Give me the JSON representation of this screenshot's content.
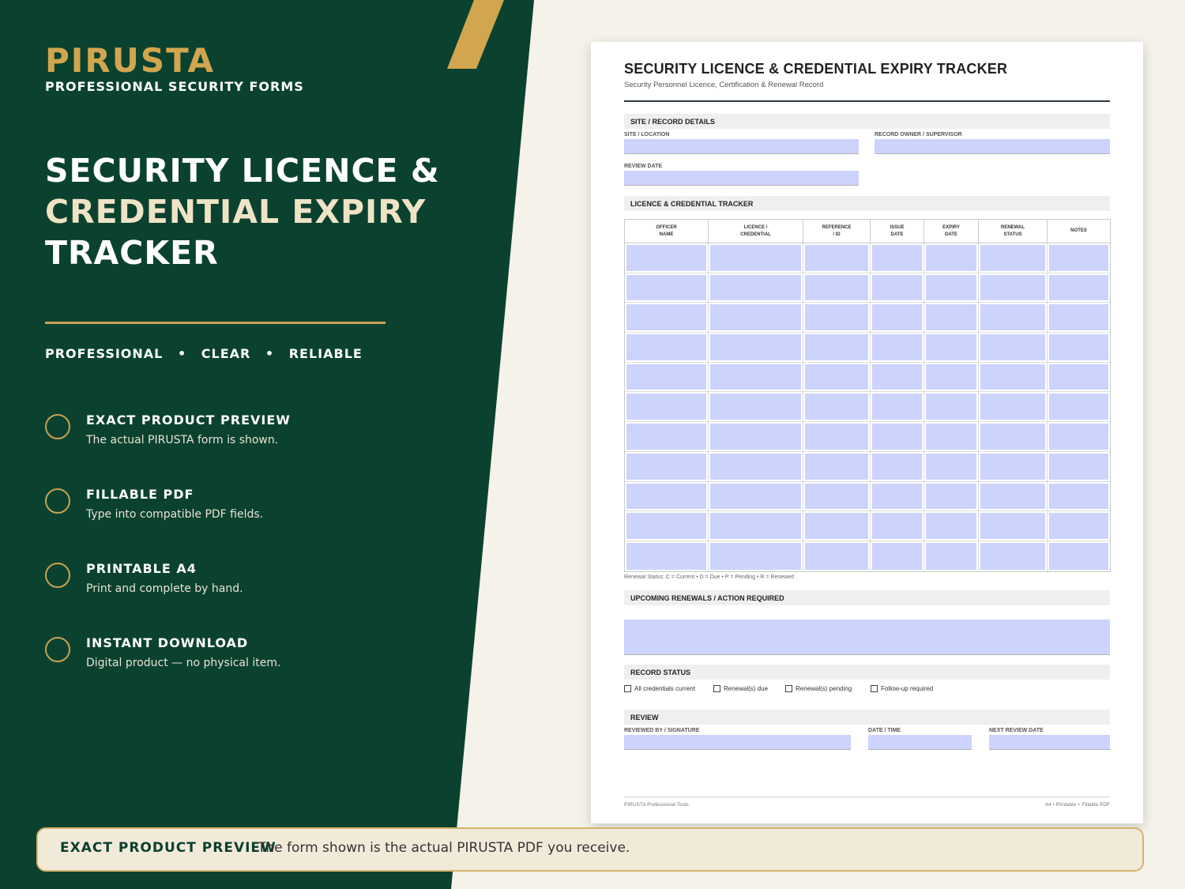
{
  "colors": {
    "panel_green": "#0b422f",
    "gold": "#d2a64e",
    "cream": "#f5f2ea",
    "field_fill": "#ccd3fd"
  },
  "brand": {
    "name": "PIRUSTA",
    "subtitle": "PROFESSIONAL SECURITY FORMS"
  },
  "hero": {
    "line1": "SECURITY LICENCE &",
    "line2": "CREDENTIAL EXPIRY",
    "line3": "TRACKER"
  },
  "tagline": {
    "items": [
      "PROFESSIONAL",
      "CLEAR",
      "RELIABLE"
    ],
    "separator": "•"
  },
  "features": [
    {
      "icon": "circle-icon",
      "title": "EXACT PRODUCT PREVIEW",
      "desc": "The actual PIRUSTA form is shown."
    },
    {
      "icon": "circle-icon",
      "title": "FILLABLE PDF",
      "desc": "Type into compatible PDF fields."
    },
    {
      "icon": "circle-icon",
      "title": "PRINTABLE A4",
      "desc": "Print and complete by hand."
    },
    {
      "icon": "circle-icon",
      "title": "INSTANT DOWNLOAD",
      "desc": "Digital product — no physical item."
    }
  ],
  "banner": {
    "title": "EXACT PRODUCT PREVIEW",
    "text": "The form shown is the actual PIRUSTA PDF you receive."
  },
  "doc": {
    "title": "SECURITY LICENCE & CREDENTIAL EXPIRY TRACKER",
    "subtitle": "Security Personnel Licence, Certification & Renewal Record",
    "site_section": {
      "heading": "SITE / RECORD DETAILS",
      "site_label": "SITE / LOCATION",
      "owner_label": "RECORD OWNER / SUPERVISOR",
      "review_date_label": "REVIEW DATE"
    },
    "tracker": {
      "heading": "LICENCE & CREDENTIAL TRACKER",
      "columns": [
        {
          "line1": "OFFICER",
          "line2": "NAME"
        },
        {
          "line1": "LICENCE /",
          "line2": "CREDENTIAL"
        },
        {
          "line1": "REFERENCE",
          "line2": "/ ID"
        },
        {
          "line1": "ISSUE",
          "line2": "DATE"
        },
        {
          "line1": "EXPIRY",
          "line2": "DATE"
        },
        {
          "line1": "RENEWAL",
          "line2": "STATUS"
        },
        {
          "line1": "NOTES",
          "line2": ""
        }
      ],
      "legend": "Renewal Status: C = Current   •   D = Due   •   P = Pending   •   R = Renewed"
    },
    "renewals": {
      "heading": "UPCOMING RENEWALS / ACTION REQUIRED"
    },
    "status": {
      "heading": "RECORD STATUS",
      "options": [
        "All credentials current",
        "Renewal(s) due",
        "Renewal(s) pending",
        "Follow-up required"
      ]
    },
    "review": {
      "heading": "REVIEW",
      "reviewed_by_label": "REVIEWED BY / SIGNATURE",
      "datetime_label": "DATE / TIME",
      "next_review_label": "NEXT REVIEW DATE"
    },
    "footer_left": "PIRUSTA Professional Tools",
    "footer_right": "A4 • Printable + Fillable PDF"
  }
}
